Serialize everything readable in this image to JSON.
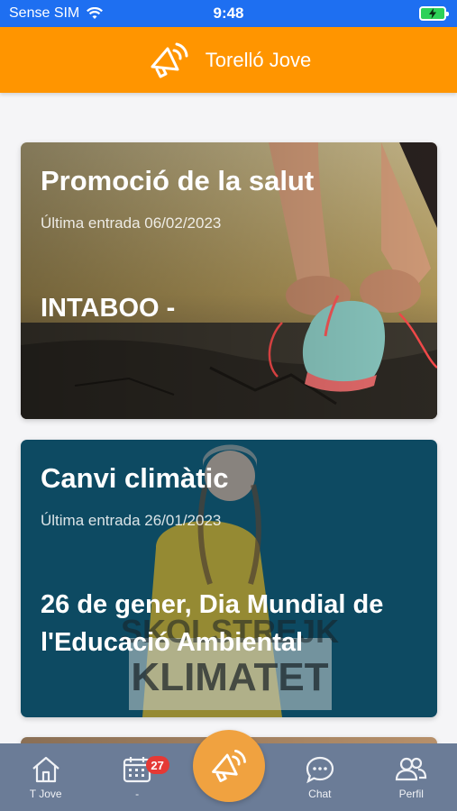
{
  "status_bar": {
    "carrier": "Sense SIM",
    "time": "9:48"
  },
  "header": {
    "title": "Torelló Jove",
    "icon": "megaphone-icon"
  },
  "cards": [
    {
      "title": "Promoció de la salut",
      "meta": "Última entrada 06/02/2023",
      "post_title": "INTABOO -"
    },
    {
      "title": "Canvi climàtic",
      "meta": "Última entrada 26/01/2023",
      "post_title": "26 de gener, Dia Mundial de l'Educació Ambiental"
    }
  ],
  "tabbar": {
    "tabs": [
      {
        "label": "T Jove",
        "icon": "home-icon"
      },
      {
        "label": "-",
        "icon": "calendar-icon",
        "badge": "27"
      },
      {
        "label": "Chat",
        "icon": "chat-icon"
      },
      {
        "label": "Perfil",
        "icon": "users-icon"
      }
    ],
    "center_icon": "megaphone-icon"
  },
  "colors": {
    "status_bar": "#1e6ff1",
    "header": "#ff9500",
    "tabbar": "#6b7c97",
    "fab": "#f0a240",
    "card_2": "#0e4a62",
    "badge": "#e53935"
  }
}
